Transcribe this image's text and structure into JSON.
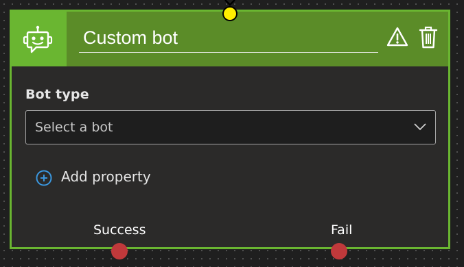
{
  "node": {
    "title": "Custom bot",
    "header_icon": "bot-icon",
    "actions": {
      "warning_icon": "warning-icon",
      "delete_icon": "trash-icon"
    },
    "fields": {
      "bot_type": {
        "label": "Bot type",
        "placeholder": "Select a bot",
        "icon": "chevron-down-icon"
      }
    },
    "add_property": {
      "label": "Add property",
      "icon": "plus-circle-icon"
    },
    "outputs": [
      {
        "label": "Success"
      },
      {
        "label": "Fail"
      }
    ]
  },
  "colors": {
    "border": "#6ab631",
    "header": "#5b8c28",
    "body": "#2b2a29",
    "input_port": "#ffee00",
    "output_port": "#c0393b",
    "accent_blue": "#3a96dd"
  }
}
